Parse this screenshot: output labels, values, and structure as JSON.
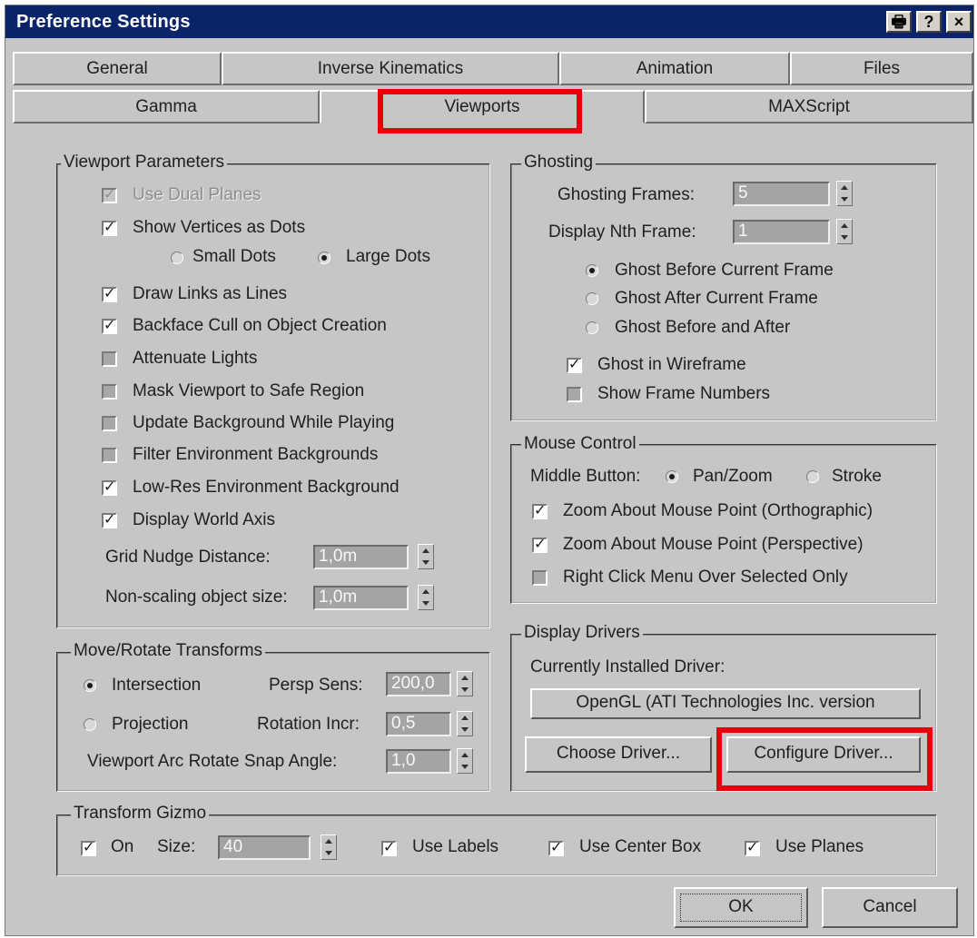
{
  "window": {
    "title": "Preference Settings",
    "buttons": {
      "print": "🖶",
      "help": "?",
      "close": "×"
    }
  },
  "tabs": {
    "row1": [
      "General",
      "Inverse Kinematics",
      "Animation",
      "Files"
    ],
    "row2": [
      "Gamma",
      "Viewports",
      "MAXScript"
    ],
    "active": "Viewports"
  },
  "viewport_parameters": {
    "title": "Viewport Parameters",
    "use_dual_planes": {
      "label": "Use Dual Planes",
      "checked": true,
      "disabled": true
    },
    "show_vertices_as_dots": {
      "label": "Show Vertices as Dots",
      "checked": true
    },
    "small_dots": "Small Dots",
    "large_dots": "Large Dots",
    "draw_links_as_lines": {
      "label": "Draw Links as Lines",
      "checked": true
    },
    "backface_cull": {
      "label": "Backface Cull on Object Creation",
      "checked": true
    },
    "attenuate_lights": {
      "label": "Attenuate Lights",
      "checked": false
    },
    "mask_viewport": {
      "label": "Mask Viewport to Safe Region",
      "checked": false
    },
    "update_background": {
      "label": "Update Background While Playing",
      "checked": false
    },
    "filter_env": {
      "label": "Filter Environment Backgrounds",
      "checked": false
    },
    "low_res_env": {
      "label": "Low-Res Environment Background",
      "checked": true
    },
    "display_world_axis": {
      "label": "Display World Axis",
      "checked": true
    },
    "grid_nudge": {
      "label": "Grid Nudge Distance:",
      "value": "1,0m"
    },
    "non_scaling": {
      "label": "Non-scaling object size:",
      "value": "1,0m"
    }
  },
  "move_rotate": {
    "title": "Move/Rotate Transforms",
    "intersection": "Intersection",
    "projection": "Projection",
    "persp_sens": {
      "label": "Persp Sens:",
      "value": "200,0"
    },
    "rotation_incr": {
      "label": "Rotation Incr:",
      "value": "0,5"
    },
    "arc_rotate": {
      "label": "Viewport Arc Rotate Snap Angle:",
      "value": "1,0"
    }
  },
  "ghosting": {
    "title": "Ghosting",
    "frames": {
      "label": "Ghosting Frames:",
      "value": "5"
    },
    "nth_frame": {
      "label": "Display Nth Frame:",
      "value": "1"
    },
    "before": "Ghost Before Current Frame",
    "after": "Ghost After Current Frame",
    "before_after": "Ghost Before and After",
    "in_wireframe": {
      "label": "Ghost in Wireframe",
      "checked": true
    },
    "frame_numbers": {
      "label": "Show Frame Numbers",
      "checked": false
    }
  },
  "mouse_control": {
    "title": "Mouse Control",
    "middle_button": "Middle Button:",
    "pan_zoom": "Pan/Zoom",
    "stroke": "Stroke",
    "zoom_ortho": {
      "label": "Zoom About Mouse Point (Orthographic)",
      "checked": true
    },
    "zoom_persp": {
      "label": "Zoom About Mouse Point (Perspective)",
      "checked": true
    },
    "right_click": {
      "label": "Right Click Menu Over Selected Only",
      "checked": false
    }
  },
  "display_drivers": {
    "title": "Display Drivers",
    "installed_label": "Currently Installed Driver:",
    "installed_value": "OpenGL (ATI Technologies Inc. version",
    "choose": "Choose Driver...",
    "configure": "Configure Driver..."
  },
  "transform_gizmo": {
    "title": "Transform Gizmo",
    "on": {
      "label": "On",
      "checked": true
    },
    "size": {
      "label": "Size:",
      "value": "40"
    },
    "use_labels": {
      "label": "Use Labels",
      "checked": true
    },
    "use_center_box": {
      "label": "Use Center Box",
      "checked": true
    },
    "use_planes": {
      "label": "Use Planes",
      "checked": true
    }
  },
  "footer": {
    "ok": "OK",
    "cancel": "Cancel"
  },
  "highlight_color": "#e8000b"
}
